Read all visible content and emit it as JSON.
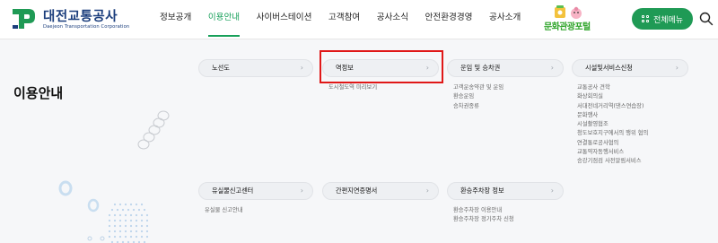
{
  "header": {
    "logo_ko": "대전교통공사",
    "logo_en": "Daejeon Transportation Corporation",
    "brand_color": "#1a3d7c",
    "accent_color": "#18a05a",
    "gnb": [
      {
        "label": "정보공개"
      },
      {
        "label": "이용안내"
      },
      {
        "label": "사이버스테이션"
      },
      {
        "label": "고객참여"
      },
      {
        "label": "공사소식"
      },
      {
        "label": "안전환경경영"
      },
      {
        "label": "공사소개"
      }
    ],
    "gnb_active_index": 1,
    "culture_portal_label": "문화관광포털",
    "all_menu_label": "전체메뉴",
    "all_menu_icon": "grid-icon",
    "search_icon": "search-icon"
  },
  "page": {
    "title": "이용안내"
  },
  "menu": {
    "chevron": "›",
    "highlight_color": "#e01818",
    "groups": [
      {
        "label": "노선도",
        "items": []
      },
      {
        "label": "역정보",
        "items": [
          "도시철도역 미리보기"
        ]
      },
      {
        "label": "운임 및 승차권",
        "items": [
          "고객운송약관 및 운임",
          "환승운임",
          "승차권종류"
        ]
      },
      {
        "label": "시설및서비스신청",
        "items": [
          "교통공사 견학",
          "화상회의실",
          "서대전네거리역(댄스연습장)",
          "문화행사",
          "시설촬영협조",
          "청도보호지구에서의 행위 협의",
          "연결통로공사협의",
          "교통약자동행서비스",
          "승강기점검 사전알림서비스"
        ]
      },
      {
        "label": "유실물신고센터",
        "items": [
          "유실물 신고안내"
        ]
      },
      {
        "label": "간편지연증명서",
        "items": []
      },
      {
        "label": "환승주차장 정보",
        "items": [
          "환승주차장 이용안내",
          "환승주차장 정기주차 신청"
        ]
      }
    ]
  }
}
